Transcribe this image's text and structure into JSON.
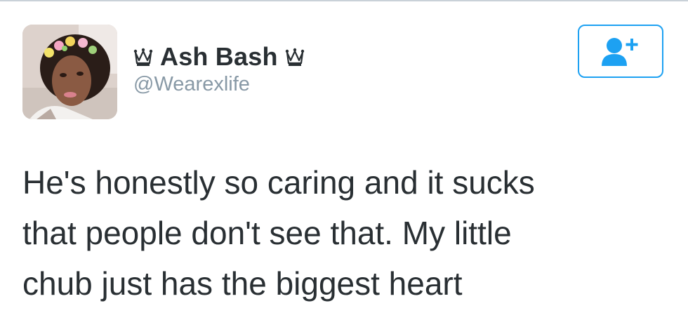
{
  "author": {
    "name": "Ash Bash",
    "handle": "@Wearexlife",
    "name_prefix_symbol": "♛",
    "name_suffix_symbol": "♛",
    "avatar": {
      "icon": "profile-photo"
    }
  },
  "follow_button": {
    "icon": "add-user-icon",
    "accent_color": "#1da1f2"
  },
  "tweet": {
    "lines": [
      "He's honestly so caring and it sucks",
      "that people don't see that. My little",
      "chub just has the biggest heart"
    ]
  },
  "colors": {
    "text": "#292f33",
    "secondary_text": "#8899a6",
    "accent": "#1da1f2"
  }
}
